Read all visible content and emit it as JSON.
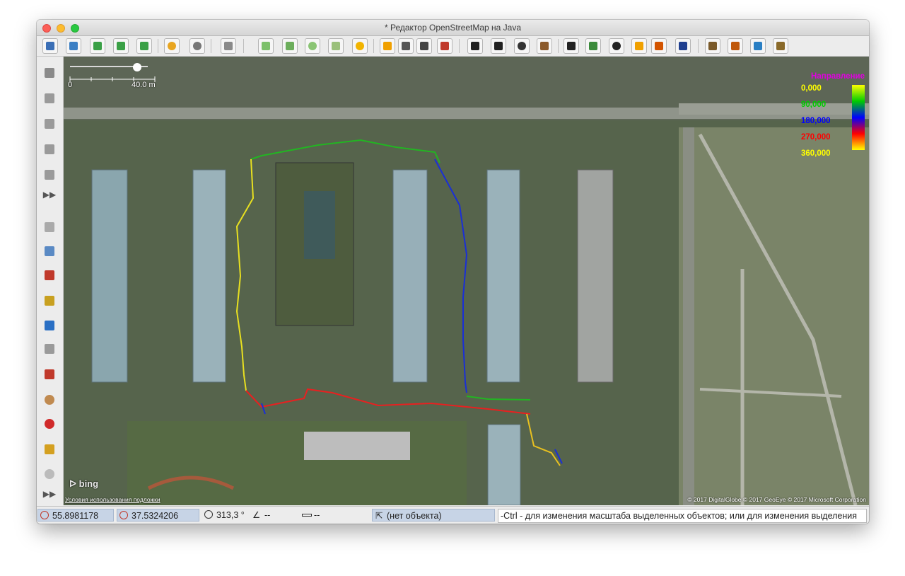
{
  "window": {
    "title": "* Редактор OpenStreetMap на Java"
  },
  "map": {
    "scale_zero": "0",
    "scale_label": "40.0 m",
    "legend": {
      "title": "Направление",
      "values": [
        "0,000",
        "90,000",
        "180,000",
        "270,000",
        "360,000"
      ],
      "colors": [
        "#ffff00",
        "#00cc00",
        "#0000ff",
        "#ff0000",
        "#ffff00"
      ]
    },
    "provider_logo": "bing",
    "terms_link": "Условия использования подложки",
    "copyright": "© 2017 DigitalGlobe © 2017 GeoEye © 2017 Microsoft Corporation"
  },
  "status": {
    "lat": "55.8981178",
    "lon": "37.5324206",
    "heading": "313,3 °",
    "angle": "--",
    "distance": "--",
    "object": "(нет объекта)",
    "help": "-Ctrl - для изменения масштаба выделенных объектов; или для изменения выделения"
  },
  "icons": {
    "toolbar": [
      "open-file-icon",
      "save-icon",
      "download-icon",
      "download-selection-icon",
      "upload-icon",
      "undo-icon",
      "redo-icon",
      "preferences-icon",
      "zoom-to-data-icon",
      "zoom-to-selection-icon",
      "zoom-icon",
      "wms-icon",
      "wireframe-icon",
      "traffic-light-icon",
      "road-icon",
      "traffic-signal-icon",
      "barrier-icon",
      "car-icon",
      "bus-icon",
      "bicycle-icon",
      "railway-icon",
      "phone-icon",
      "playground-icon",
      "sports-icon",
      "shop-icon",
      "warning-icon",
      "info-icon",
      "industrial-icon",
      "peak-icon",
      "waterway-icon",
      "castle-icon"
    ],
    "leftbar": [
      "select-tool-icon",
      "draw-line-icon",
      "delete-tool-icon",
      "improve-way-icon",
      "draw-icon",
      "more-tools-icon",
      "layers-icon",
      "tags-icon",
      "relations-icon",
      "selection-list-icon",
      "conflicts-icon",
      "filter-icon",
      "validator-icon",
      "map-paint-icon",
      "notes-icon",
      "changeset-icon",
      "wiki-icon",
      "more-panels-icon"
    ]
  }
}
